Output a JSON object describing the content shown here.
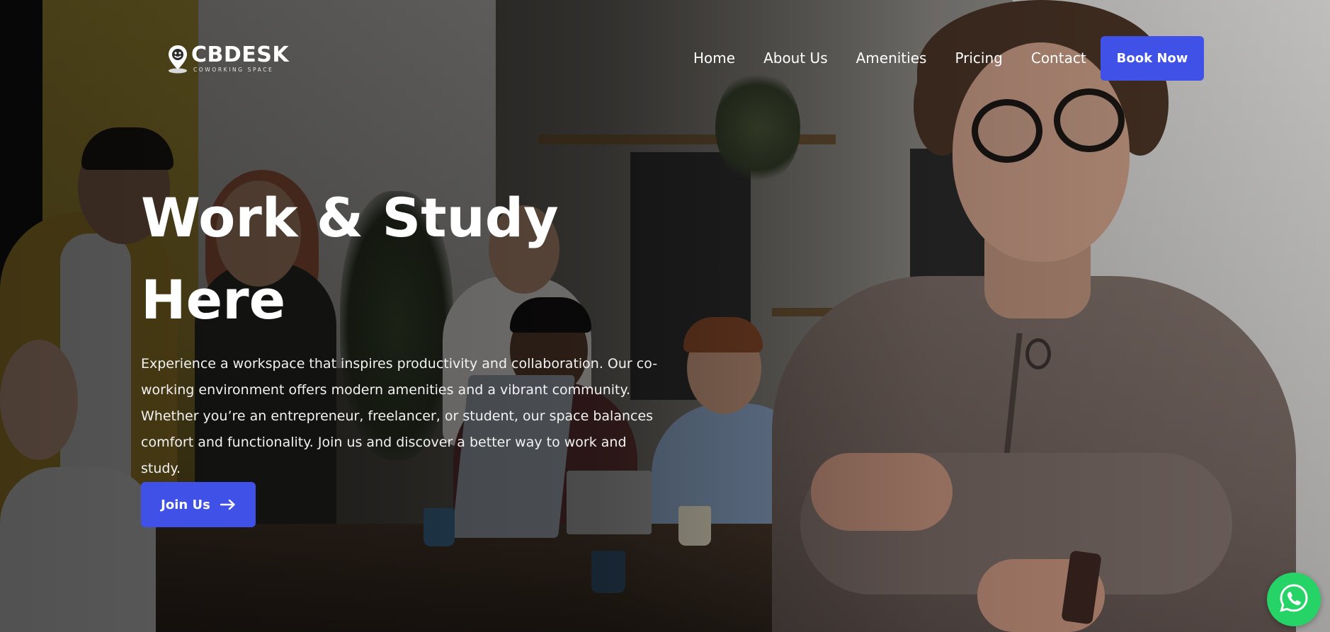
{
  "brand": {
    "name": "CBDESK",
    "tagline": "COWORKING SPACE",
    "logo_icon": "location-pin-smiley-icon"
  },
  "nav": {
    "items": [
      "Home",
      "About Us",
      "Amenities",
      "Pricing",
      "Contact"
    ],
    "cta_label": "Book Now"
  },
  "hero": {
    "title_line1": "Work & Study",
    "title_line2": "Here",
    "description": "Experience a workspace that inspires productivity and collaboration. Our co-working environment offers modern amenities and a vibrant community. Whether you’re an entrepreneur, freelancer, or student, our space balances comfort and functionality. Join us and discover a better way to work and study.",
    "cta_label": "Join Us",
    "cta_icon": "arrow-right-icon",
    "background_image": "blurred-coworking-office-photo"
  },
  "floating": {
    "whatsapp_icon": "whatsapp-icon"
  },
  "colors": {
    "accent": "#3f51e6",
    "whatsapp": "#25d366",
    "text": "#ffffff"
  }
}
